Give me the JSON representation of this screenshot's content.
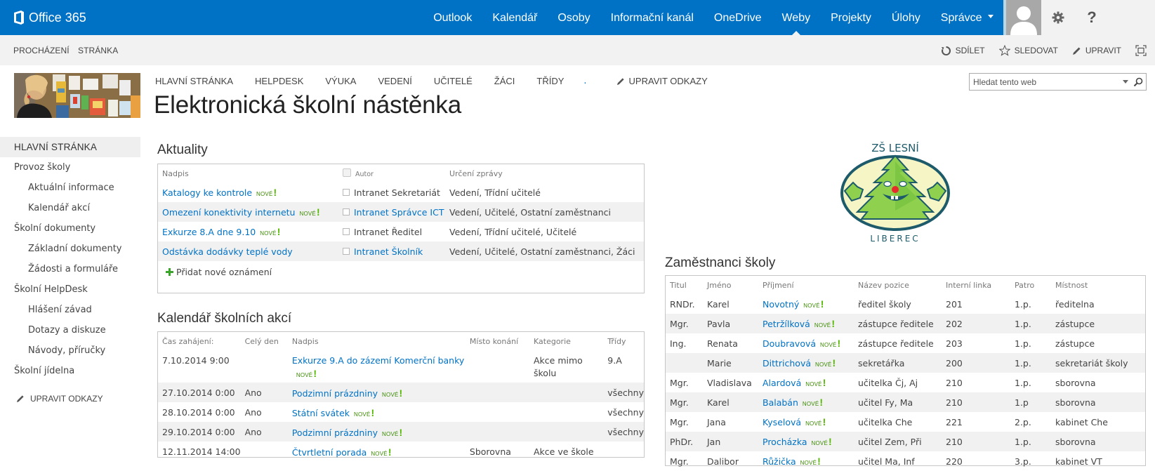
{
  "suitebar": {
    "brand": "Office 365",
    "links": [
      {
        "label": "Outlook",
        "active": false
      },
      {
        "label": "Kalendář",
        "active": false
      },
      {
        "label": "Osoby",
        "active": false
      },
      {
        "label": "Informační kanál",
        "active": false
      },
      {
        "label": "OneDrive",
        "active": false
      },
      {
        "label": "Weby",
        "active": true
      },
      {
        "label": "Projekty",
        "active": false
      },
      {
        "label": "Úlohy",
        "active": false
      },
      {
        "label": "Správce",
        "active": false,
        "has_dropdown": true
      }
    ],
    "icons": [
      "avatar-icon",
      "gear-icon",
      "help-icon"
    ],
    "help_label": "?",
    "colors": {
      "suitebar_bg": "#0072c6",
      "right_bg": "#f2f2f2"
    }
  },
  "ribbon": {
    "tabs": [
      "PROCHÁZENÍ",
      "STRÁNKA"
    ],
    "actions": [
      {
        "label": "SDÍLET",
        "icon": "share-icon"
      },
      {
        "label": "SLEDOVAT",
        "icon": "star-icon"
      },
      {
        "label": "UPRAVIT",
        "icon": "pencil-icon"
      }
    ],
    "focus_icon": "focus-content-icon"
  },
  "site": {
    "title": "Elektronická školní nástěnka",
    "topnav": [
      "HLAVNÍ STRÁNKA",
      "HELPDESK",
      "VÝUKA",
      "VEDENÍ",
      "UČITELÉ",
      "ŽÁCI",
      "TŘÍDY"
    ],
    "topnav_dot": ".",
    "edit_links": "UPRAVIT ODKAZY",
    "search": {
      "placeholder": "Hledat tento web",
      "value": ""
    }
  },
  "leftnav": {
    "items": [
      {
        "label": "HLAVNÍ STRÁNKA",
        "level": 0,
        "selected": true
      },
      {
        "label": "Provoz školy",
        "level": 0
      },
      {
        "label": "Aktuální informace",
        "level": 1
      },
      {
        "label": "Kalendář akcí",
        "level": 1
      },
      {
        "label": "Školní dokumenty",
        "level": 0
      },
      {
        "label": "Základní dokumenty",
        "level": 1
      },
      {
        "label": "Žádosti a formuláře",
        "level": 1
      },
      {
        "label": "Školní HelpDesk",
        "level": 0
      },
      {
        "label": "Hlášení závad",
        "level": 1
      },
      {
        "label": "Dotazy a diskuze",
        "level": 1
      },
      {
        "label": "Návody, příručky",
        "level": 1
      },
      {
        "label": "Školní jídelna",
        "level": 0
      }
    ],
    "edit_links": "UPRAVIT ODKAZY"
  },
  "new_badge": "NOVÉ",
  "new_mark": "!",
  "aktuality": {
    "title": "Aktuality",
    "columns": [
      "Nadpis",
      "Autor",
      "Určení zprávy"
    ],
    "rows": [
      {
        "nadpis": "Katalogy ke kontrole",
        "new": true,
        "autor": "Intranet Sekretariát",
        "autor_link": false,
        "urceni": "Vedení, Třídní učitelé"
      },
      {
        "nadpis": "Omezení konektivity internetu",
        "new": true,
        "autor": "Intranet Správce ICT",
        "autor_link": true,
        "urceni": "Vedení, Učitelé, Ostatní zaměstnanci"
      },
      {
        "nadpis": "Exkurze 8.A dne 9.10",
        "new": true,
        "autor": "Intranet Ředitel",
        "autor_link": false,
        "urceni": "Vedení, Třídní učitelé, Učitelé"
      },
      {
        "nadpis": "Odstávka dodávky teplé vody",
        "new": false,
        "autor": "Intranet Školník",
        "autor_link": true,
        "urceni": "Vedení, Učitelé, Ostatní zaměstnanci, Žáci"
      }
    ],
    "add_label": "Přidat nové oznámení"
  },
  "kalendar": {
    "title": "Kalendář školních akcí",
    "columns": [
      "Čas zahájení:",
      "Celý den",
      "Nadpis",
      "Místo konání",
      "Kategorie",
      "Třídy"
    ],
    "rows": [
      {
        "cas": "7.10.2014 9:00",
        "cely_den": "",
        "nadpis": "Exkurze 9.A do zázemí Komerční banky",
        "new": true,
        "misto": "",
        "kategorie": "Akce mimo školu",
        "tridy": "9.A"
      },
      {
        "cas": "27.10.2014 0:00",
        "cely_den": "Ano",
        "nadpis": "Podzimní prázdniny",
        "new": true,
        "misto": "",
        "kategorie": "",
        "tridy": "všechny"
      },
      {
        "cas": "28.10.2014 0:00",
        "cely_den": "Ano",
        "nadpis": "Státní svátek",
        "new": true,
        "misto": "",
        "kategorie": "",
        "tridy": "všechny"
      },
      {
        "cas": "29.10.2014 0:00",
        "cely_den": "Ano",
        "nadpis": "Podzimní prázdniny",
        "new": true,
        "misto": "",
        "kategorie": "",
        "tridy": "všechny"
      },
      {
        "cas": "12.11.2014 14:00",
        "cely_den": "",
        "nadpis": "Čtvrtletní porada",
        "new": true,
        "misto": "Sborovna",
        "kategorie": "Akce ve škole",
        "tridy": ""
      }
    ]
  },
  "school_logo": {
    "top_text": "ZŠ LESNÍ",
    "bottom_text": "LIBEREC"
  },
  "zamestnanci": {
    "title": "Zaměstnanci školy",
    "columns": [
      "Titul",
      "Jméno",
      "Příjmení",
      "Název pozice",
      "Interní linka",
      "Patro",
      "Místnost"
    ],
    "rows": [
      {
        "titul": "RNDr.",
        "jmeno": "Karel",
        "prijmeni": "Novotný",
        "pozice": "ředitel školy",
        "linka": "201",
        "patro": "1.p.",
        "mistnost": "ředitelna"
      },
      {
        "titul": "Mgr.",
        "jmeno": "Pavla",
        "prijmeni": "Petržílková",
        "pozice": "zástupce ředitele",
        "linka": "202",
        "patro": "1.p.",
        "mistnost": "zástupce"
      },
      {
        "titul": "Ing.",
        "jmeno": "Renata",
        "prijmeni": "Doubravová",
        "pozice": "zástupce ředitele",
        "linka": "203",
        "patro": "1.p.",
        "mistnost": "zástupce"
      },
      {
        "titul": "",
        "jmeno": "Marie",
        "prijmeni": "Dittrichová",
        "pozice": "sekretářka",
        "linka": "200",
        "patro": "1.p.",
        "mistnost": "sekretariát školy"
      },
      {
        "titul": "Mgr.",
        "jmeno": "Vladislava",
        "prijmeni": "Alardová",
        "pozice": "učitelka Čj, Aj",
        "linka": "210",
        "patro": "1.p.",
        "mistnost": "sborovna"
      },
      {
        "titul": "Mgr.",
        "jmeno": "Karel",
        "prijmeni": "Balabán",
        "pozice": "učitel Fy, Ma",
        "linka": "210",
        "patro": "1.p",
        "mistnost": "sborovna"
      },
      {
        "titul": "Mgr.",
        "jmeno": "Jana",
        "prijmeni": "Kyselová",
        "pozice": "učitelka Che",
        "linka": "221",
        "patro": "2.p.",
        "mistnost": "kabinet Che"
      },
      {
        "titul": "PhDr.",
        "jmeno": "Jan",
        "prijmeni": "Procházka",
        "pozice": "učitel Zem, Při",
        "linka": "210",
        "patro": "1.p.",
        "mistnost": "sborovna"
      },
      {
        "titul": "Mgr.",
        "jmeno": "Dalibor",
        "prijmeni": "Růžička",
        "pozice": "učitel Ma, Inf",
        "linka": "220",
        "patro": "3.p.",
        "mistnost": "kabinet VT"
      }
    ]
  }
}
